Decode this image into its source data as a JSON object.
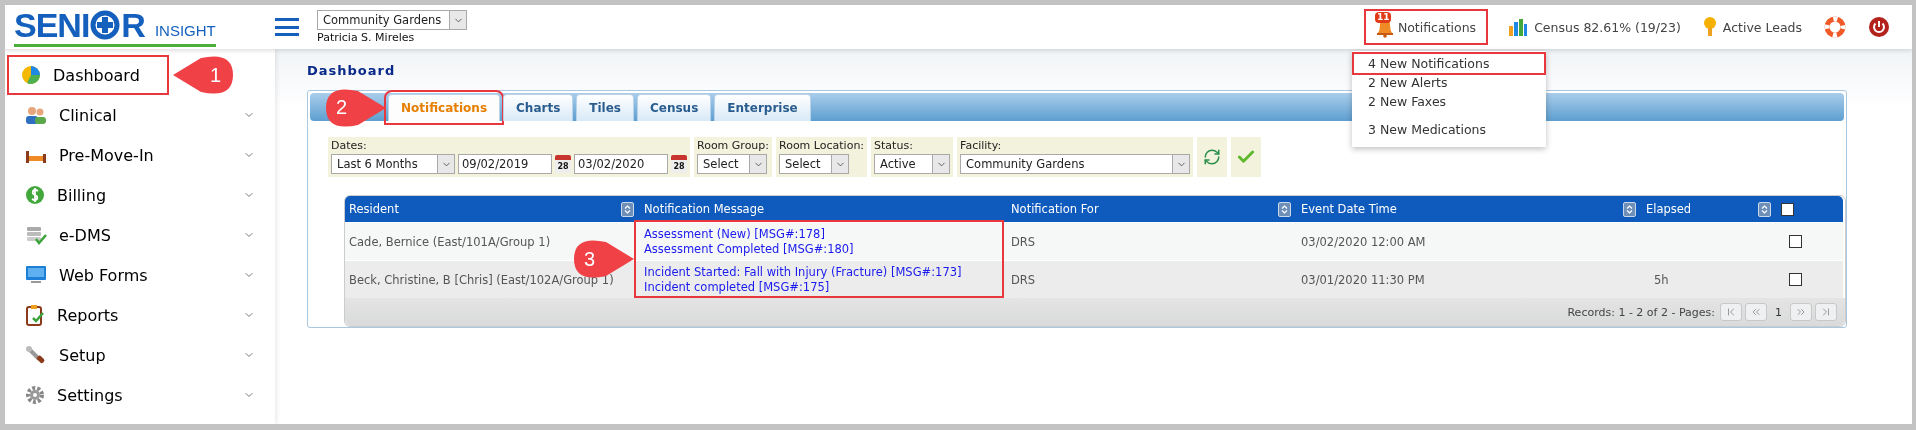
{
  "logo": {
    "brand_start": "SENI",
    "brand_end": "R",
    "tagline": "INSIGHT"
  },
  "header": {
    "facility": "Community Gardens",
    "user": "Patricia S. Mireles",
    "notifications": {
      "label": "Notifications",
      "count": "11",
      "highlighted": true
    },
    "census": "Census 82.61% (19/23)",
    "leads": "Active Leads"
  },
  "notification_menu": [
    [
      {
        "label": "4 New Notifications",
        "highlighted": true
      },
      {
        "label": "2 New Alerts",
        "highlighted": false
      },
      {
        "label": "2 New Faxes",
        "highlighted": false
      }
    ],
    [
      {
        "label": "3 New Medications",
        "highlighted": false
      }
    ]
  ],
  "sidebar": [
    {
      "label": "Dashboard",
      "highlighted": true,
      "callout": "1",
      "expandable": false
    },
    {
      "label": "Clinical",
      "highlighted": false,
      "expandable": true
    },
    {
      "label": "Pre-Move-In",
      "highlighted": false,
      "expandable": true
    },
    {
      "label": "Billing",
      "highlighted": false,
      "expandable": true
    },
    {
      "label": "e-DMS",
      "highlighted": false,
      "expandable": true
    },
    {
      "label": "Web Forms",
      "highlighted": false,
      "expandable": true
    },
    {
      "label": "Reports",
      "highlighted": false,
      "expandable": true
    },
    {
      "label": "Setup",
      "highlighted": false,
      "expandable": true
    },
    {
      "label": "Settings",
      "highlighted": false,
      "expandable": true
    }
  ],
  "page_title": "Dashboard",
  "tabs": [
    {
      "label": "Notifications",
      "selected": true,
      "highlighted": true,
      "callout": "2"
    },
    {
      "label": "Charts",
      "selected": false,
      "highlighted": false
    },
    {
      "label": "Tiles",
      "selected": false,
      "highlighted": false
    },
    {
      "label": "Census",
      "selected": false,
      "highlighted": false
    },
    {
      "label": "Enterprise",
      "selected": false,
      "highlighted": false
    }
  ],
  "filters": {
    "dates": {
      "label": "Dates:",
      "range": "Last 6 Months",
      "from": "09/02/2019",
      "to": "03/02/2020",
      "from_calendar_day": "28",
      "to_calendar_day": "28"
    },
    "room_group": {
      "label": "Room Group:",
      "value": "Select"
    },
    "room_location": {
      "label": "Room Location:",
      "value": "Select"
    },
    "status": {
      "label": "Status:",
      "value": "Active"
    },
    "facility": {
      "label": "Facility:",
      "value": "Community Gardens"
    }
  },
  "table": {
    "columns": [
      {
        "kind": "text",
        "label": "Resident",
        "sortable": true
      },
      {
        "kind": "text",
        "label": "Notification Message",
        "sortable": false
      },
      {
        "kind": "text",
        "label": "Notification For",
        "sortable": true
      },
      {
        "kind": "text",
        "label": "Event Date Time",
        "sortable": true
      },
      {
        "kind": "text",
        "label": "Elapsed",
        "sortable": true
      },
      {
        "kind": "checkbox",
        "checked": false
      }
    ],
    "rows": [
      {
        "resident": "Cade, Bernice (East/101A/Group 1)",
        "messages": [
          "Assessment (New) [MSG#:178]",
          "Assessment Completed [MSG#:180]"
        ],
        "for": "DRS",
        "event": "03/02/2020 12:00 AM",
        "checked": false
      },
      {
        "resident": "Beck, Christine, B [Chris] (East/102A/Group 1)",
        "messages": [
          "Incident Started: Fall with Injury (Fracture) [MSG#:173]",
          "Incident completed [MSG#:175]"
        ],
        "for": "DRS",
        "event": "03/01/2020 11:30 PM",
        "elapsed": "5h",
        "checked": false
      }
    ],
    "messages_highlight": {
      "callout": "3"
    },
    "footer": {
      "records": "Records: 1 - 2 of 2 - Pages:",
      "page": "1"
    }
  }
}
